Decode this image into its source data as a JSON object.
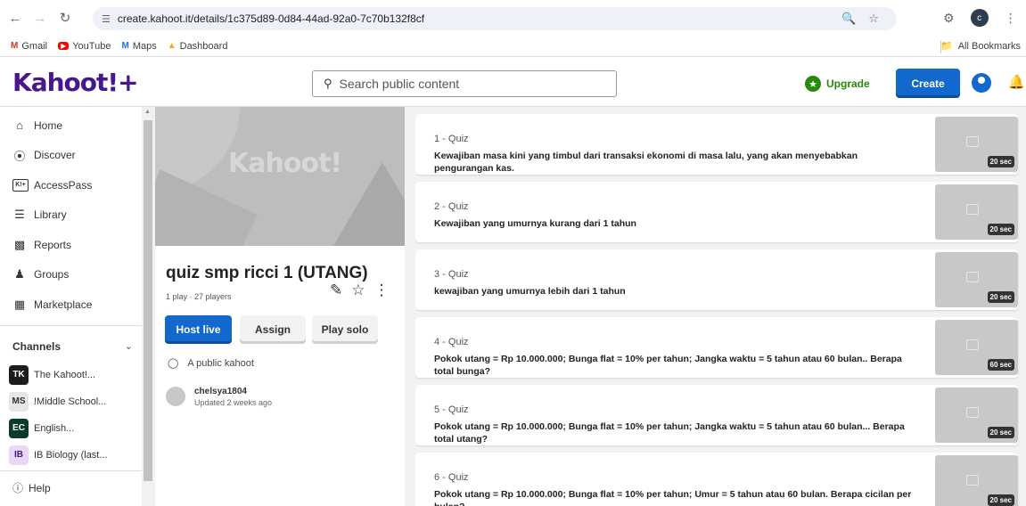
{
  "browser": {
    "url": "create.kahoot.it/details/1c375d89-0d84-44ad-92a0-7c70b132f8cf",
    "profile_initial": "c",
    "bookmarks": [
      {
        "label": "Gmail",
        "icon": "gmail-icon"
      },
      {
        "label": "YouTube",
        "icon": "youtube-icon"
      },
      {
        "label": "Maps",
        "icon": "maps-icon"
      },
      {
        "label": "Dashboard",
        "icon": "dashboard-icon"
      }
    ],
    "all_bookmarks": "All Bookmarks"
  },
  "header": {
    "logo": "Kahoot!+",
    "search_placeholder": "Search public content",
    "upgrade": "Upgrade",
    "create": "Create"
  },
  "sidebar": {
    "items": [
      {
        "label": "Home",
        "icon": "home-icon"
      },
      {
        "label": "Discover",
        "icon": "compass-icon"
      },
      {
        "label": "AccessPass",
        "icon": "accesspass-icon"
      },
      {
        "label": "Library",
        "icon": "list-icon"
      },
      {
        "label": "Reports",
        "icon": "reports-icon"
      },
      {
        "label": "Groups",
        "icon": "groups-icon"
      },
      {
        "label": "Marketplace",
        "icon": "marketplace-icon"
      }
    ],
    "channels_label": "Channels",
    "channels": [
      {
        "badge": "TK",
        "label": "The Kahoot!...",
        "color": "#1d1d1d"
      },
      {
        "badge": "MS",
        "label": "!Middle School...",
        "color": "#e6e6e6"
      },
      {
        "badge": "EC",
        "label": "English...",
        "color": "#0a3b2c"
      },
      {
        "badge": "IB",
        "label": "IB Biology (last...",
        "color": "#e8d8f5"
      }
    ],
    "help": "Help"
  },
  "kahoot": {
    "cover_logo": "Kahoot!",
    "title": "quiz smp ricci 1 (UTANG)",
    "meta": "1 play · 27 players",
    "host_live": "Host live",
    "assign": "Assign",
    "play_solo": "Play solo",
    "visibility": "A public kahoot",
    "owner": "chelsya1804",
    "updated": "Updated 2 weeks ago"
  },
  "questions": [
    {
      "num": "1 - Quiz",
      "text": "Kewajiban masa kini yang timbul dari transaksi ekonomi di masa lalu, yang akan menyebabkan pengurangan kas.",
      "time": "20 sec"
    },
    {
      "num": "2 - Quiz",
      "text": "Kewajiban yang umurnya kurang dari 1 tahun",
      "time": "20 sec"
    },
    {
      "num": "3 - Quiz",
      "text": "kewajiban yang umurnya lebih dari 1 tahun",
      "time": "20 sec"
    },
    {
      "num": "4 - Quiz",
      "text": "Pokok utang = Rp 10.000.000; Bunga flat = 10% per tahun; Jangka waktu = 5 tahun atau 60 bulan.. Berapa total bunga?",
      "time": "60 sec"
    },
    {
      "num": "5 - Quiz",
      "text": "Pokok utang = Rp 10.000.000; Bunga flat = 10% per tahun; Jangka waktu = 5 tahun atau 60 bulan... Berapa total utang?",
      "time": "20 sec"
    },
    {
      "num": "6 - Quiz",
      "text": "Pokok utang = Rp 10.000.000; Bunga flat = 10% per tahun; Umur = 5 tahun atau 60 bulan. Berapa cicilan per bulan?",
      "time": "20 sec"
    }
  ]
}
